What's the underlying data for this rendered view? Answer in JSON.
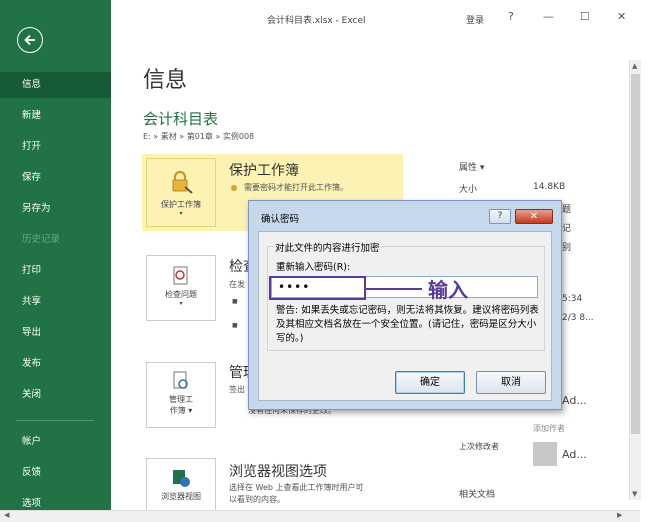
{
  "window": {
    "title": "会计科目表.xlsx - Excel",
    "login": "登录",
    "help": "?",
    "minimize": "—",
    "maximize": "☐",
    "close": "✕"
  },
  "sidebar": {
    "items": [
      {
        "label": "信息",
        "active": true
      },
      {
        "label": "新建"
      },
      {
        "label": "打开"
      },
      {
        "label": "保存"
      },
      {
        "label": "另存为"
      },
      {
        "label": "历史记录",
        "disabled": true
      },
      {
        "label": "打印"
      },
      {
        "label": "共享"
      },
      {
        "label": "导出"
      },
      {
        "label": "发布"
      },
      {
        "label": "关闭"
      },
      {
        "label": "帐户"
      },
      {
        "label": "反馈"
      },
      {
        "label": "选项"
      }
    ]
  },
  "main": {
    "page_title": "信息",
    "file_title": "会计科目表",
    "breadcrumb": "E: » 素材 » 第01章 » 实例008",
    "protect": {
      "button": "保护工作簿",
      "title": "保护工作簿",
      "desc": "需要密码才能打开此工作簿。"
    },
    "inspect": {
      "button": "检查问题",
      "title": "检查",
      "desc": "在发"
    },
    "manage": {
      "button_line1": "管理工",
      "button_line2": "作簿",
      "title": "管理",
      "desc": "签出",
      "desc2": "没有任何未保存的更改。"
    },
    "browser": {
      "button": "浏览器视图",
      "title": "浏览器视图选项",
      "desc1": "选择在 Web 上查看此工作簿时用户可",
      "desc2": "以看到的内容。"
    }
  },
  "props": {
    "heading": "属性",
    "size_label": "大小",
    "size_value": "14.8KB",
    "partial_1": "题",
    "partial_2": "记",
    "partial_3": "别",
    "time_1": "5:34",
    "time_2": "2/3 8...",
    "author_name": "Ad...",
    "add_author": "添加作者",
    "last_modified_by": "上次修改者",
    "modifier_name": "Ad...",
    "related_docs": "相关文档"
  },
  "dialog": {
    "title": "确认密码",
    "help": "?",
    "close": "✕",
    "group_label": "对此文件的内容进行加密",
    "password_label": "重新输入密码(R):",
    "password_value": "••••",
    "warning": "警告: 如果丢失或忘记密码，则无法将其恢复。建议将密码列表及其相应文档名放在一个安全位置。(请记住，密码是区分大小写的。)",
    "ok": "确定",
    "cancel": "取消"
  },
  "annotation": {
    "text": "输入"
  },
  "colors": {
    "sidebar": "#217346",
    "annotation": "#5b3aa0",
    "protect_highlight": "#fbf2b4"
  }
}
